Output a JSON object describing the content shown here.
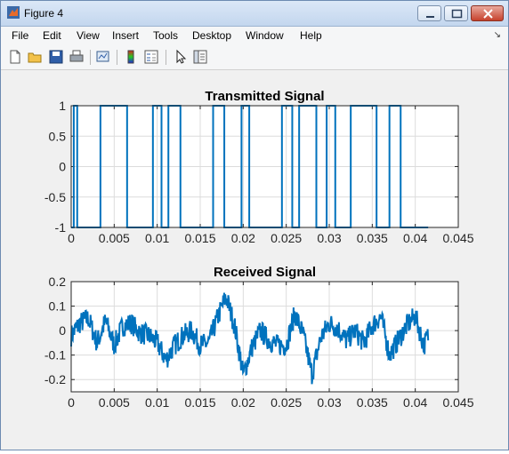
{
  "window": {
    "title": "Figure 4"
  },
  "menu": [
    "File",
    "Edit",
    "View",
    "Insert",
    "Tools",
    "Desktop",
    "Window",
    "Help"
  ],
  "toolbar_icons": [
    "new-figure-icon",
    "open-file-icon",
    "save-icon",
    "print-icon",
    "link-plot-icon",
    "colorbar-icon",
    "legend-icon",
    "pointer-icon",
    "property-editor-icon"
  ],
  "colors": {
    "line": "#0072bd",
    "axes_bg": "#ffffff",
    "figure_bg": "#f0f0f0",
    "grid": "#dcdcdc"
  },
  "chart_data": [
    {
      "type": "line",
      "title": "Transmitted Signal",
      "xlabel": "",
      "ylabel": "",
      "xlim": [
        0,
        0.045
      ],
      "ylim": [
        -1,
        1
      ],
      "x_ticks": [
        "0",
        "0.005",
        "0.01",
        "0.015",
        "0.02",
        "0.025",
        "0.03",
        "0.035",
        "0.04",
        "0.045"
      ],
      "y_ticks": [
        "-1",
        "-0.5",
        "0",
        "0.5",
        "1"
      ],
      "grid": true,
      "x_end": 0.0415,
      "transitions": [
        0.0003,
        0.0007,
        0.0034,
        0.0065,
        0.0095,
        0.0105,
        0.0113,
        0.0127,
        0.0165,
        0.0178,
        0.0198,
        0.0207,
        0.0245,
        0.0257,
        0.0265,
        0.0285,
        0.0297,
        0.0307,
        0.0325,
        0.0355,
        0.037,
        0.0383
      ],
      "start_value": -1
    },
    {
      "type": "line",
      "title": "Received Signal",
      "xlabel": "",
      "ylabel": "",
      "xlim": [
        0,
        0.045
      ],
      "ylim": [
        -0.25,
        0.2
      ],
      "x_ticks": [
        "0",
        "0.005",
        "0.01",
        "0.015",
        "0.02",
        "0.025",
        "0.03",
        "0.035",
        "0.04",
        "0.045"
      ],
      "y_ticks": [
        "-0.2",
        "-0.1",
        "0",
        "0.1",
        "0.2"
      ],
      "grid": true,
      "x_end": 0.0415,
      "envelope": [
        [
          0.0,
          -0.02
        ],
        [
          0.001,
          0.03
        ],
        [
          0.002,
          0.05
        ],
        [
          0.003,
          -0.05
        ],
        [
          0.004,
          0.04
        ],
        [
          0.005,
          -0.06
        ],
        [
          0.006,
          0.02
        ],
        [
          0.007,
          0.03
        ],
        [
          0.008,
          -0.01
        ],
        [
          0.009,
          -0.02
        ],
        [
          0.01,
          -0.05
        ],
        [
          0.011,
          -0.12
        ],
        [
          0.012,
          -0.06
        ],
        [
          0.013,
          -0.02
        ],
        [
          0.014,
          0.0
        ],
        [
          0.015,
          -0.06
        ],
        [
          0.016,
          -0.05
        ],
        [
          0.017,
          0.05
        ],
        [
          0.018,
          0.14
        ],
        [
          0.019,
          0.02
        ],
        [
          0.02,
          -0.18
        ],
        [
          0.021,
          -0.07
        ],
        [
          0.022,
          0.0
        ],
        [
          0.023,
          -0.04
        ],
        [
          0.024,
          -0.06
        ],
        [
          0.025,
          -0.06
        ],
        [
          0.026,
          0.07
        ],
        [
          0.027,
          -0.02
        ],
        [
          0.028,
          -0.18
        ],
        [
          0.029,
          -0.03
        ],
        [
          0.03,
          0.03
        ],
        [
          0.031,
          0.01
        ],
        [
          0.032,
          -0.04
        ],
        [
          0.033,
          0.0
        ],
        [
          0.034,
          -0.05
        ],
        [
          0.035,
          0.02
        ],
        [
          0.036,
          0.06
        ],
        [
          0.037,
          -0.1
        ],
        [
          0.038,
          -0.04
        ],
        [
          0.039,
          0.02
        ],
        [
          0.04,
          0.06
        ],
        [
          0.041,
          -0.06
        ],
        [
          0.0415,
          -0.02
        ]
      ]
    }
  ]
}
